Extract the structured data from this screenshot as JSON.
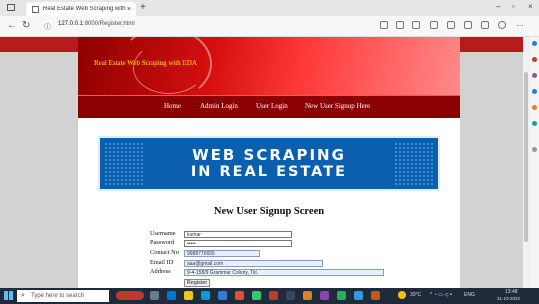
{
  "browser": {
    "tab_title": "Real Estate Web Scraping with E",
    "tab_close": "×",
    "new_tab": "+",
    "url_host": "127.0.0.1",
    "url_rest": ":8000/Register.html",
    "win_min": "–",
    "win_max": "▫",
    "win_close": "×"
  },
  "site": {
    "title": "Real Estate Web Scraping with EDA",
    "nav": [
      "Home",
      "Admin Login",
      "User Login",
      "New User Signup Here"
    ],
    "hero_line1": "WEB SCRAPING",
    "hero_line2": "IN REAL ESTATE",
    "form_title": "New User Signup Screen"
  },
  "form": {
    "username_label": "Username",
    "username_value": "kumar",
    "password_label": "Password",
    "password_value": "•••••",
    "contact_label": "Contact No",
    "contact_value": "9988776655",
    "email_label": "Email ID",
    "email_value": "aaa@gmail.com",
    "address_label": "Address",
    "address_value": "9-4-158/9 Grammar Colony, Tol.",
    "register_label": "Register"
  },
  "taskbar": {
    "search_placeholder": "Type here to search",
    "weather": "30°C",
    "lang": "ENG",
    "time": "13:48",
    "date": "31-10-2022"
  },
  "colors": {
    "banner_red": "#d50f0f",
    "nav_red": "#8b0000",
    "title_yellow": "#ffe600",
    "hero_blue": "#0a5fae"
  }
}
